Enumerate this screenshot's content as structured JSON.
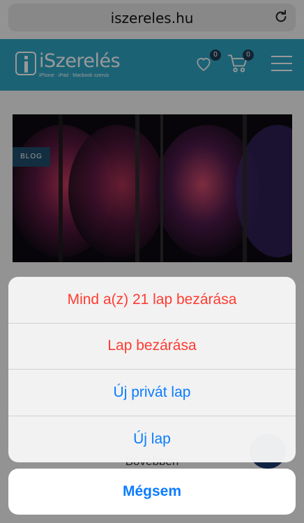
{
  "browser": {
    "url": "iszereles.hu",
    "reload_icon": "reload-icon"
  },
  "site": {
    "logo_name": "iSzerelés",
    "logo_tagline": "iPhone · iPad · Macbook szerviz",
    "favorites_count": "0",
    "cart_count": "0",
    "brand_color": "#2fa3c4"
  },
  "hero": {
    "tag": "BLOG"
  },
  "behind": {
    "more_text": "Bővebben"
  },
  "action_sheet": {
    "close_all": "Mind a(z) 21 lap bezárása",
    "close_tab": "Lap bezárása",
    "new_private_tab": "Új privát lap",
    "new_tab": "Új lap",
    "cancel": "Mégsem",
    "destructive_color": "#ff3b30",
    "action_color": "#0a7cff"
  }
}
